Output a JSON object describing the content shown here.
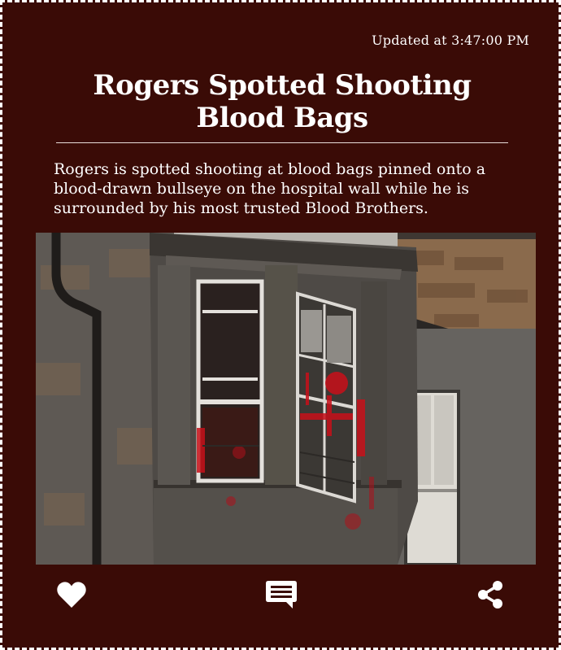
{
  "post": {
    "updated": "Updated at 3:47:00 PM",
    "title": "Rogers Spotted Shooting Blood Bags",
    "description": "Rogers is spotted shooting at blood bags pinned onto a blood-drawn bullseye on the hospital wall while he is surrounded by his most trusted Blood Brothers."
  },
  "actions": [
    {
      "icon": "heart-icon"
    },
    {
      "icon": "comment-icon"
    },
    {
      "icon": "share-icon"
    }
  ],
  "colors": {
    "background": "#3a0b06",
    "text": "#ffffff",
    "border": "#ffffff",
    "blood": "#c8101a"
  }
}
